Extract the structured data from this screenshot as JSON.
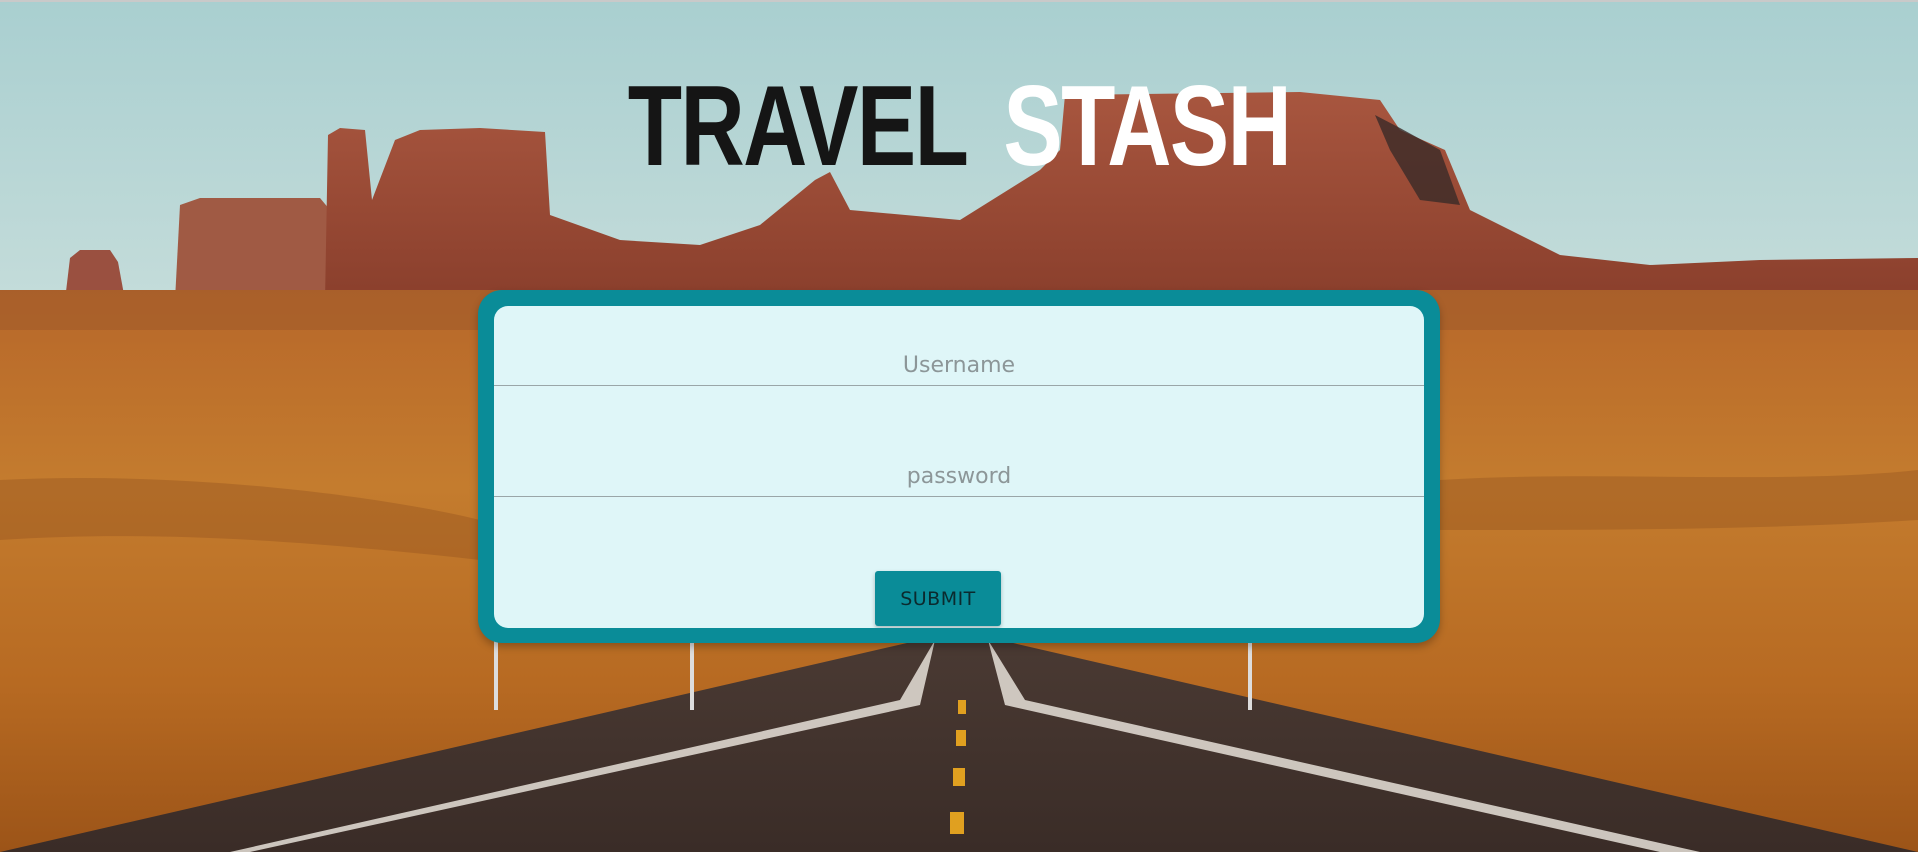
{
  "brand": {
    "word1": "TRAVEL",
    "word2": "STASH"
  },
  "login_form": {
    "username_placeholder": "Username",
    "password_placeholder": "password",
    "submit_label": "SUBMIT"
  },
  "colors": {
    "accent": "#0a8c98",
    "form_background": "#dff6f8",
    "title_dark": "#151515",
    "title_light": "#ffffff"
  },
  "background": {
    "scene": "desert-highway-with-mesas"
  }
}
